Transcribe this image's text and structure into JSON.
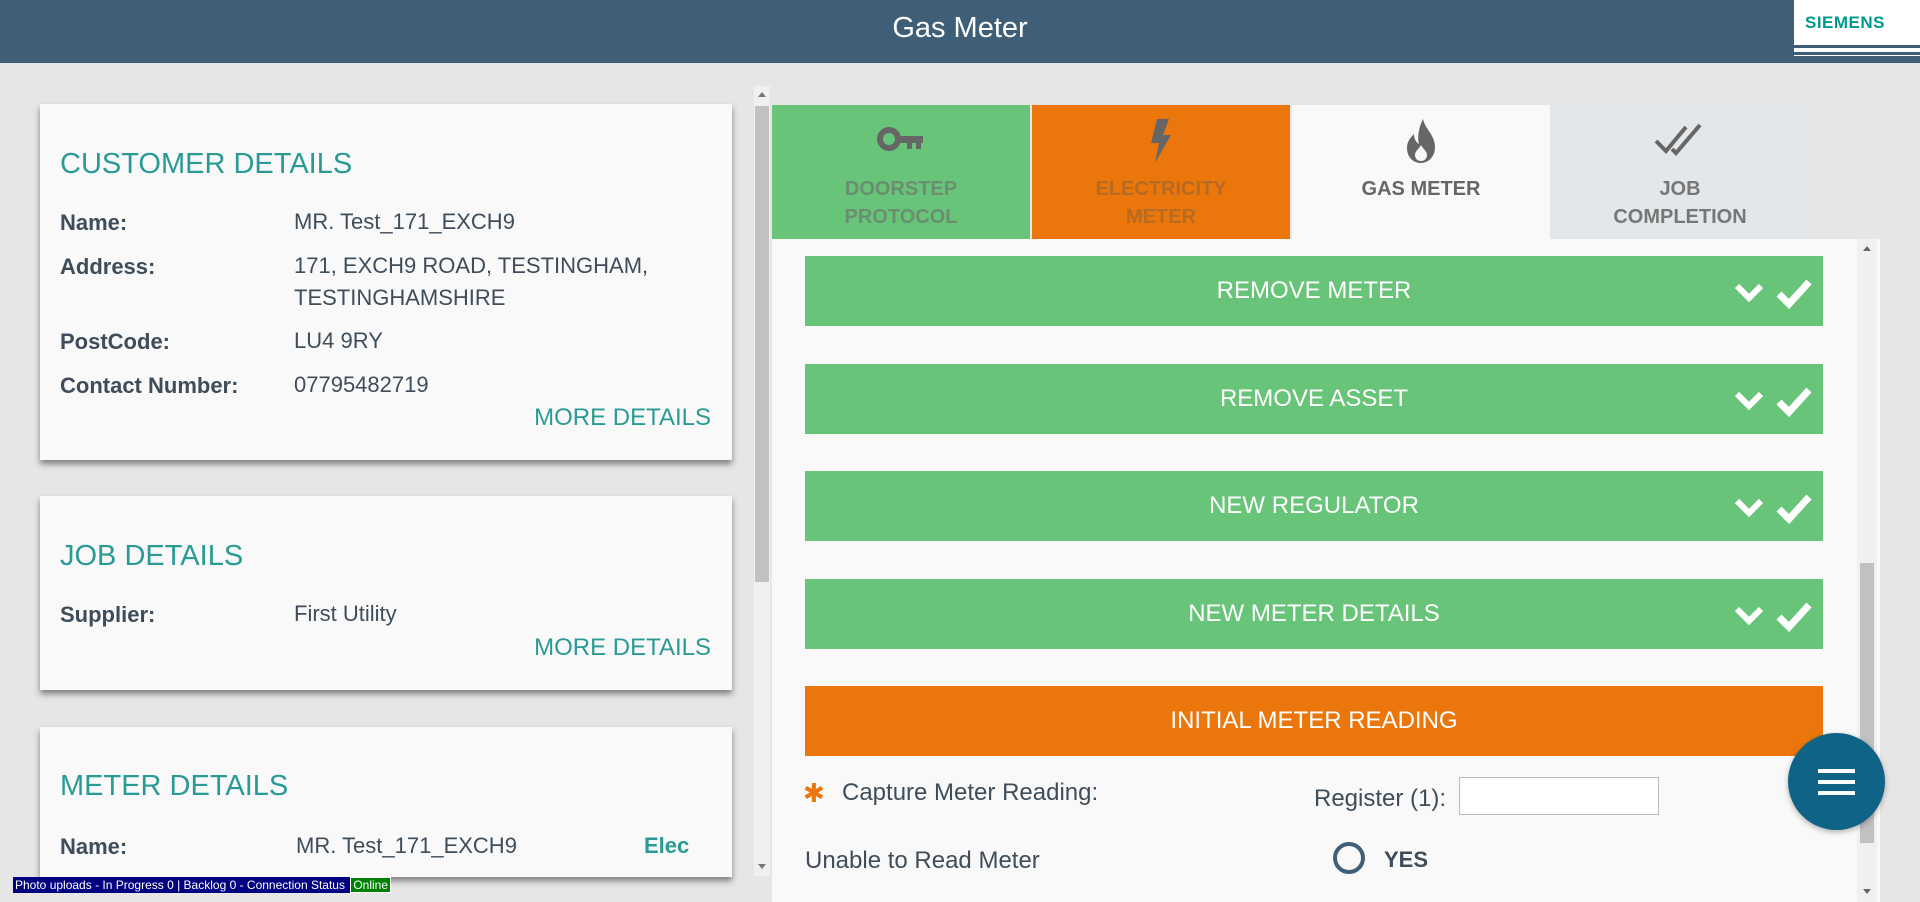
{
  "header": {
    "title": "Gas Meter",
    "logo": "SIEMENS"
  },
  "customer_details": {
    "heading": "CUSTOMER DETAILS",
    "rows": [
      {
        "label": "Name:",
        "value": "MR. Test_171_EXCH9"
      },
      {
        "label": "Address:",
        "value_line1": "171, EXCH9 ROAD, TESTINGHAM,",
        "value_line2": "TESTINGHAMSHIRE"
      },
      {
        "label": "PostCode:",
        "value": "LU4 9RY"
      },
      {
        "label": "Contact Number:",
        "value": "07795482719"
      }
    ],
    "more_link": "MORE DETAILS"
  },
  "job_details": {
    "heading": "JOB DETAILS",
    "rows": [
      {
        "label": "Supplier:",
        "value": "First Utility"
      }
    ],
    "more_link": "MORE DETAILS"
  },
  "meter_details": {
    "heading": "METER DETAILS",
    "rows": [
      {
        "label": "Name:",
        "value": "MR. Test_171_EXCH9",
        "type": "Elec"
      }
    ]
  },
  "tabs": [
    {
      "line1": "DOORSTEP",
      "line2": "PROTOCOL",
      "icon": "key-icon",
      "state": "complete",
      "bg": "#67c478"
    },
    {
      "line1": "ELECTRICITY",
      "line2": "METER",
      "icon": "lightning-icon",
      "state": "in-progress",
      "bg": "#eb770c"
    },
    {
      "line1": "GAS METER",
      "line2": "",
      "icon": "flame-icon",
      "state": "active",
      "bg": "#f9f9f9"
    },
    {
      "line1": "JOB",
      "line2": "COMPLETION",
      "icon": "double-check-icon",
      "state": "pending",
      "bg": "#e4e7e9"
    }
  ],
  "sections": [
    {
      "label": "REMOVE METER",
      "state": "complete"
    },
    {
      "label": "REMOVE ASSET",
      "state": "complete"
    },
    {
      "label": "NEW REGULATOR",
      "state": "complete"
    },
    {
      "label": "NEW METER DETAILS",
      "state": "complete"
    },
    {
      "label": "INITIAL METER READING",
      "state": "active"
    }
  ],
  "reading_form": {
    "required_marker": "✱",
    "capture_label": "Capture Meter Reading:",
    "register_label": "Register (1):",
    "register_value": "",
    "unable_label": "Unable to Read Meter",
    "yes_label": "YES"
  },
  "fab": {
    "icon": "menu-icon"
  },
  "status_bar": {
    "text": "Photo uploads - In Progress 0 | Backlog 0 - Connection Status ",
    "connection": "Online"
  },
  "colors": {
    "teal": "#2a9b94",
    "green": "#67c478",
    "orange": "#eb770c",
    "header": "#3e5f77",
    "fab": "#0e6386"
  }
}
